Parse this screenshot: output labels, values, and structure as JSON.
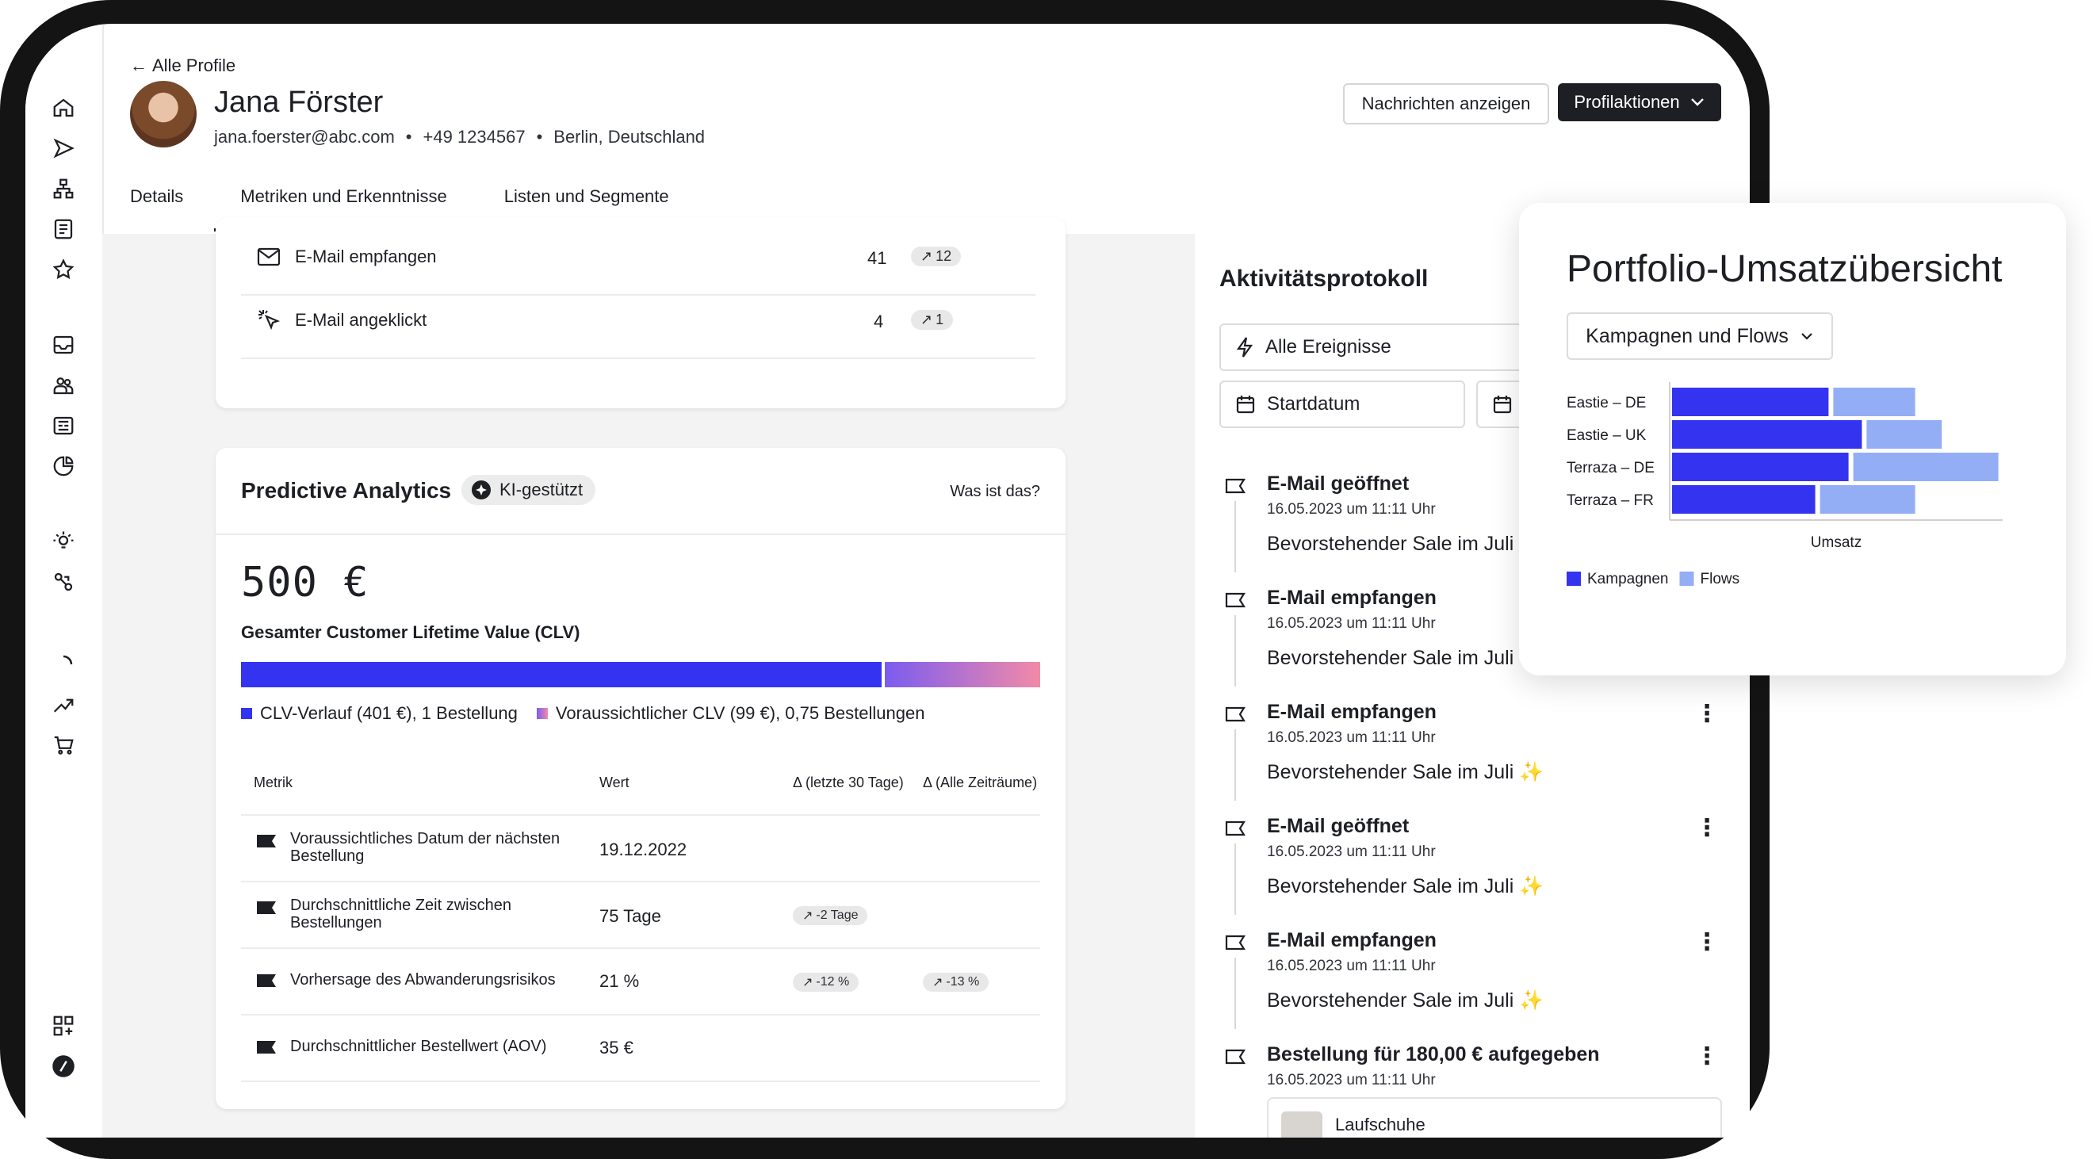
{
  "nav": {
    "back_label": "Alle Profile",
    "icons": [
      "home-icon",
      "send-icon",
      "flow-icon",
      "list-icon",
      "star-icon",
      "inbox-icon",
      "people-icon",
      "content-icon",
      "chart-icon",
      "bulb-icon",
      "integration-icon",
      "loader-icon",
      "trend-icon",
      "cart-icon",
      "grid-icon",
      "brand-icon"
    ]
  },
  "profile": {
    "name": "Jana Förster",
    "email": "jana.foerster@abc.com",
    "phone": "+49 1234567",
    "location": "Berlin, Deutschland",
    "separator": "•"
  },
  "header_actions": {
    "messages_label": "Nachrichten anzeigen",
    "profile_actions_label": "Profilaktionen"
  },
  "tabs": [
    {
      "label": "Details"
    },
    {
      "label": "Metriken und Erkenntnisse",
      "active": true
    },
    {
      "label": "Listen und Segmente"
    }
  ],
  "email_metrics": [
    {
      "icon": "mail-icon",
      "label": "E-Mail empfangen",
      "value": "41",
      "delta": "12"
    },
    {
      "icon": "click-icon",
      "label": "E-Mail angeklickt",
      "value": "4",
      "delta": "1"
    }
  ],
  "predictive": {
    "title": "Predictive Analytics",
    "badge": "KI-gestützt",
    "help": "Was ist das?",
    "clv_value": "500 €",
    "clv_label": "Gesamter Customer Lifetime Value (CLV)",
    "history_fraction": 0.802,
    "legend_history": "CLV-Verlauf (401 €), 1 Bestellung",
    "legend_predicted": "Voraussichtlicher CLV (99 €), 0,75 Bestellungen",
    "colors": {
      "history": "#3434f0",
      "predicted_start": "#7b5cf0",
      "predicted_end": "#f28aa8"
    },
    "columns": [
      "Metrik",
      "Wert",
      "Δ (letzte 30 Tage)",
      "Δ (Alle Zeiträume)"
    ],
    "rows": [
      {
        "metric": "Voraussichtliches Datum der nächsten Bestellung",
        "value": "19.12.2022",
        "d30": "",
        "dall": ""
      },
      {
        "metric": "Durchschnittliche Zeit zwischen Bestellungen",
        "value": "75 Tage",
        "d30": "-2 Tage",
        "dall": ""
      },
      {
        "metric": "Vorhersage des Abwanderungsrisikos",
        "value": "21 %",
        "d30": "-12 %",
        "dall": "-13 %"
      },
      {
        "metric": "Durchschnittlicher Bestellwert (AOV)",
        "value": "35 €",
        "d30": "",
        "dall": ""
      }
    ]
  },
  "activity": {
    "title": "Aktivitätsprotokoll",
    "filter_events": "Alle Ereignisse",
    "filter_start": "Startdatum",
    "events": [
      {
        "title": "E-Mail geöffnet",
        "time": "16.05.2023 um 11:11 Uhr",
        "subject": "Bevorstehender Sale im Juli ✨"
      },
      {
        "title": "E-Mail empfangen",
        "time": "16.05.2023 um 11:11 Uhr",
        "subject": "Bevorstehender Sale im Juli ✨"
      },
      {
        "title": "E-Mail empfangen",
        "time": "16.05.2023 um 11:11 Uhr",
        "subject": "Bevorstehender Sale im Juli ✨"
      },
      {
        "title": "E-Mail geöffnet",
        "time": "16.05.2023 um 11:11 Uhr",
        "subject": "Bevorstehender Sale im Juli ✨"
      },
      {
        "title": "E-Mail empfangen",
        "time": "16.05.2023 um 11:11 Uhr",
        "subject": "Bevorstehender Sale im Juli ✨"
      },
      {
        "title": "Bestellung für 180,00 € aufgegeben",
        "time": "16.05.2023 um 11:11 Uhr",
        "subject": "Laufschuhe"
      }
    ]
  },
  "revenue": {
    "title": "Portfolio-Umsatzübersicht",
    "select_label": "Kampagnen und Flows",
    "chart_data": {
      "type": "bar",
      "orientation": "horizontal",
      "stacked": true,
      "categories": [
        "Eastie – DE",
        "Eastie – UK",
        "Terraza – DE",
        "Terraza – FR"
      ],
      "series": [
        {
          "name": "Kampagnen",
          "color": "#3434f0",
          "values": [
            47,
            57,
            53,
            43
          ]
        },
        {
          "name": "Flows",
          "color": "#93aef5",
          "values": [
            26,
            24,
            45,
            30
          ]
        }
      ],
      "xlabel": "Umsatz",
      "xlim": [
        0,
        100
      ],
      "legend": "bottom-left"
    }
  }
}
